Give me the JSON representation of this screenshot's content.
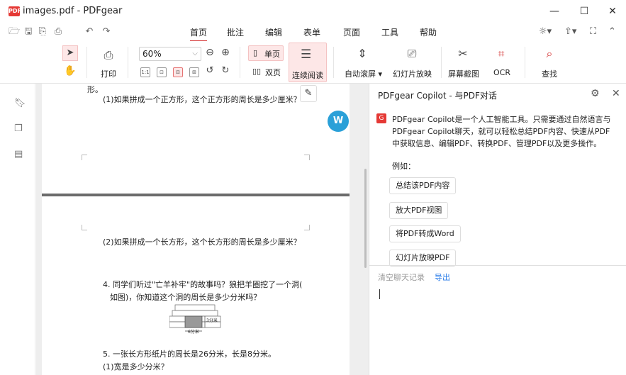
{
  "window": {
    "title": "images.pdf - PDFgear",
    "logo_text": "PDF",
    "minimize": "—",
    "maximize": "☐",
    "close": "✕"
  },
  "menu": {
    "items": [
      "首页",
      "批注",
      "编辑",
      "表单",
      "页面",
      "工具",
      "帮助"
    ],
    "active_index": 0
  },
  "ribbon": {
    "print_label": "打印",
    "zoom_value": "60%",
    "single_page_label": "单页",
    "double_page_label": "双页",
    "continuous_label": "连续阅读",
    "autoscroll_label": "自动滚屏 ▾",
    "slideshow_label": "幻灯片放映",
    "screenshot_label": "屏幕截图",
    "ocr_label": "OCR",
    "search_label": "查找",
    "fit_icon_labels": [
      "1:1",
      "⊡",
      "⊟",
      "⊞"
    ]
  },
  "document": {
    "page1_lines": [
      "形。",
      "(1)如果拼成一个正方形，这个正方形的周长是多少厘米？"
    ],
    "page2_lines": [
      "(2)如果拼成一个长方形，这个长方形的周长是多少厘米？",
      "4. 同学们听过\"亡羊补牢\"的故事吗？狼把羊圈挖了一个洞(",
      "如图)，你知道这个洞的周长是多少分米吗？",
      "5. 一张长方形纸片的周长是26分米，长是8分米。",
      "(1)宽是多少分米？"
    ],
    "figure_labels": [
      "3分米",
      "6分米"
    ],
    "fab_text": "W"
  },
  "copilot": {
    "title": "PDFgear Copilot - 与PDF对话",
    "avatar": "G",
    "intro_lines": [
      "PDFgear Copilot是一个人工智能工具。只需要通过自然语言与",
      "PDFgear Copilot聊天，就可以轻松总结PDF内容、快速从PDF",
      "中获取信息、编辑PDF、转换PDF、管理PDF以及更多操作。"
    ],
    "example_label": "例如：",
    "suggestions": [
      "总结该PDF内容",
      "放大PDF视图",
      "将PDF转成Word",
      "幻灯片放映PDF"
    ],
    "clear_label": "清空聊天记录",
    "export_label": "导出",
    "input_value": ""
  }
}
